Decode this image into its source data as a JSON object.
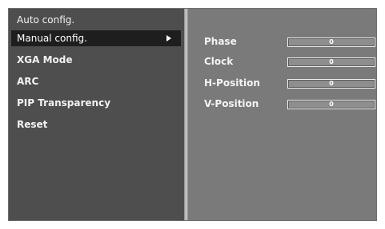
{
  "menu": {
    "items": [
      {
        "label": "Auto config."
      },
      {
        "label": "Manual config."
      },
      {
        "label": "XGA Mode"
      },
      {
        "label": "ARC"
      },
      {
        "label": "PIP Transparency"
      },
      {
        "label": "Reset"
      }
    ],
    "selected_index": 1
  },
  "params": [
    {
      "label": "Phase",
      "value": "0"
    },
    {
      "label": "Clock",
      "value": "0"
    },
    {
      "label": "H-Position",
      "value": "0"
    },
    {
      "label": "V-Position",
      "value": "0"
    }
  ],
  "colors": {
    "panel": "#4e4e4e",
    "submenu_panel": "#7a7a7a",
    "highlight": "#1e1e1e",
    "text": "#f2f2f2"
  },
  "icons": {
    "submenu_arrow": "arrow-right-icon"
  }
}
